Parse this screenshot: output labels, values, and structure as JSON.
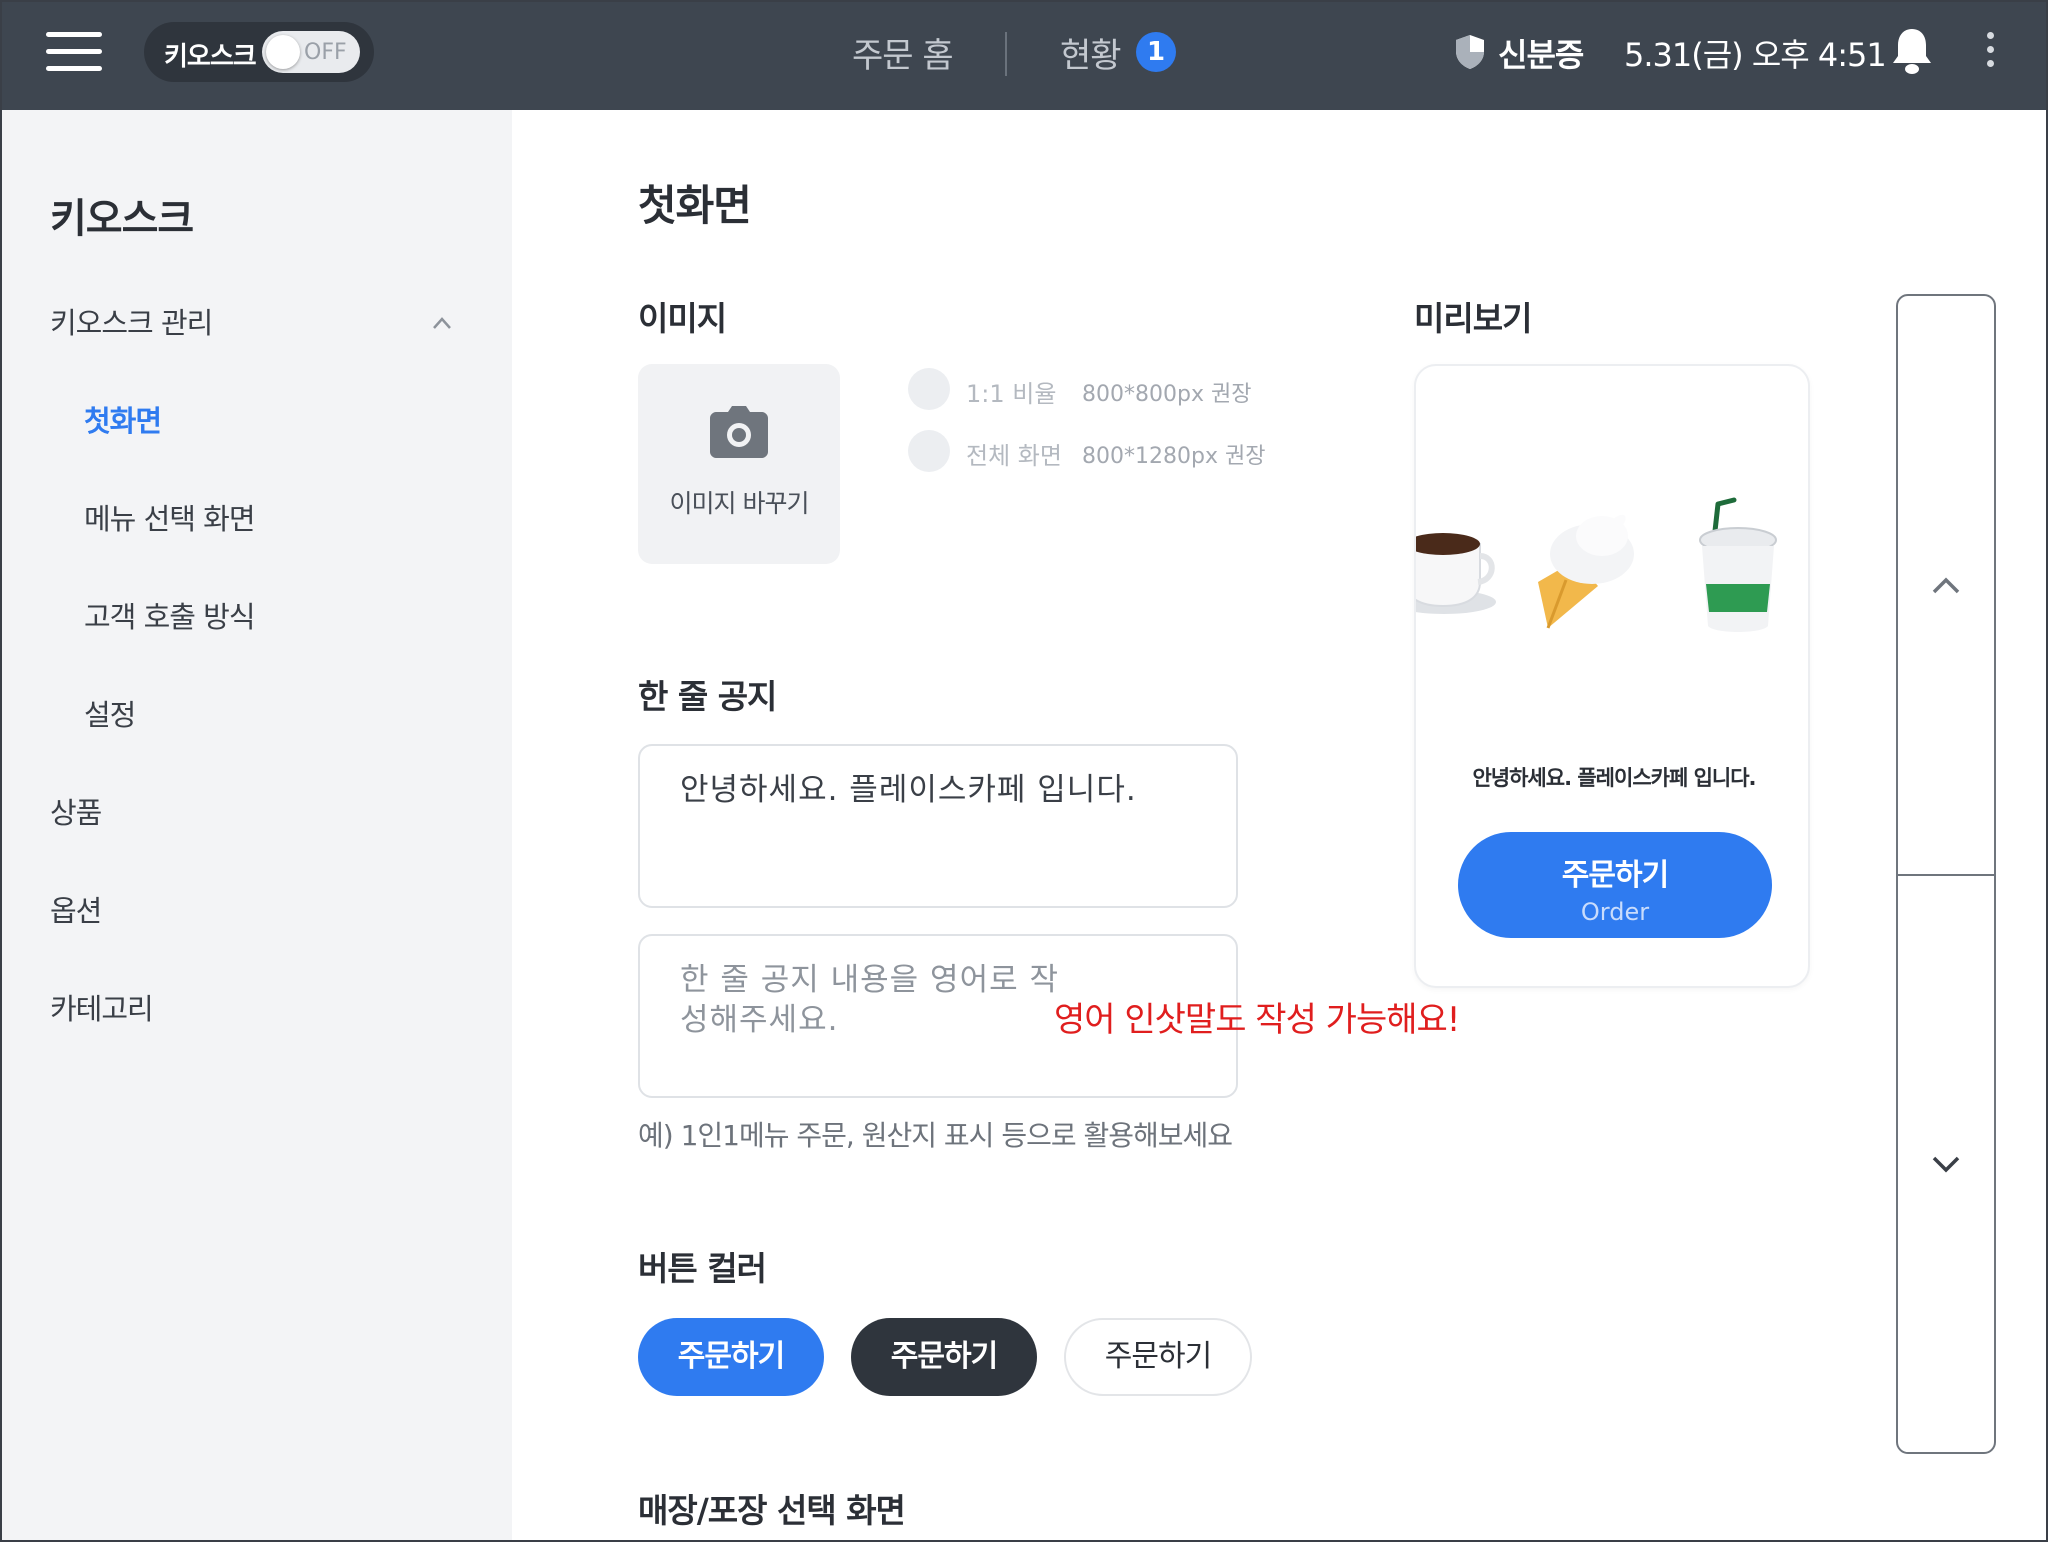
{
  "topbar": {
    "kiosk_label": "키오스크",
    "toggle_state": "OFF",
    "nav_home": "주문 홈",
    "nav_status": "현황",
    "status_badge": "1",
    "id_label": "신분증",
    "datetime": "5.31(금) 오후 4:51"
  },
  "sidebar": {
    "title": "키오스크",
    "items": [
      {
        "label": "키오스크 관리"
      },
      {
        "label": "첫화면"
      },
      {
        "label": "메뉴 선택 화면"
      },
      {
        "label": "고객 호출 방식"
      },
      {
        "label": "설정"
      },
      {
        "label": "상품"
      },
      {
        "label": "옵션"
      },
      {
        "label": "카테고리"
      }
    ]
  },
  "main": {
    "page_title": "첫화면",
    "image_section": {
      "heading": "이미지",
      "change_label": "이미지 바꾸기",
      "options": [
        {
          "label": "1:1 비율",
          "size": "800*800px 권장"
        },
        {
          "label": "전체 화면",
          "size": "800*1280px 권장"
        }
      ]
    },
    "notice_section": {
      "heading": "한 줄 공지",
      "value": "안녕하세요. 플레이스카페 입니다.",
      "english_placeholder": "한 줄 공지 내용을 영어로 작성해주세요.",
      "hint": "예) 1인1메뉴 주문, 원산지 표시 등으로 활용해보세요",
      "annotation": "영어 인삿말도 작성 가능해요!"
    },
    "button_color_section": {
      "heading": "버튼 컬러",
      "buttons": [
        {
          "label": "주문하기",
          "color": "#2f7bf0"
        },
        {
          "label": "주문하기",
          "color": "#2f353d"
        },
        {
          "label": "주문하기",
          "color": "#ffffff"
        }
      ]
    },
    "store_section": {
      "heading": "매장/포장 선택 화면"
    }
  },
  "preview": {
    "heading": "미리보기",
    "notice": "안녕하세요. 플레이스카페 입니다.",
    "button_main": "주문하기",
    "button_sub": "Order"
  },
  "colors": {
    "accent": "#2f7bf0",
    "topbar": "#3e4650",
    "annotation": "#e01e1e"
  },
  "icons": [
    "menu-icon",
    "shield-icon",
    "bell-icon",
    "more-vertical-icon",
    "camera-icon",
    "chevron-up-icon",
    "chevron-down-icon"
  ]
}
